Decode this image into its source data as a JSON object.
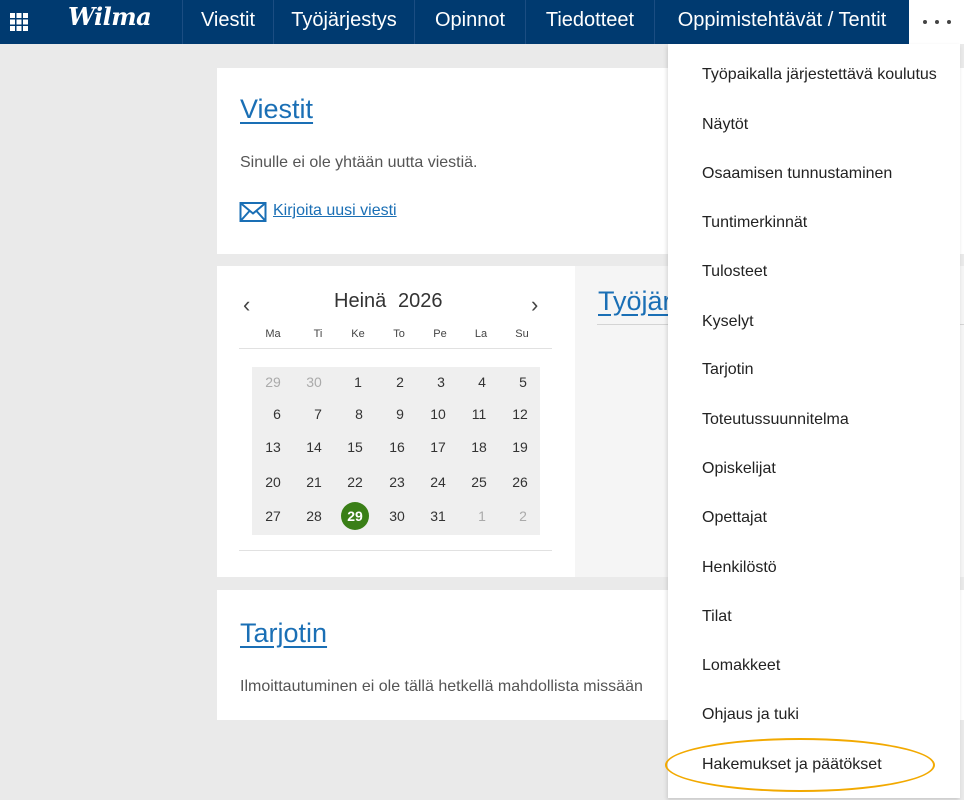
{
  "header": {
    "logo": "Wilma",
    "nav": [
      {
        "label": "Viestit"
      },
      {
        "label": "Työjärjestys"
      },
      {
        "label": "Opinnot"
      },
      {
        "label": "Tiedotteet"
      },
      {
        "label": "Oppimistehtävät / Tentit"
      }
    ],
    "more_icon": "ellipsis-icon",
    "apps_icon": "grid-icon"
  },
  "messages_card": {
    "title": "Viestit",
    "text": "Sinulle ei ole yhtään uutta viestiä.",
    "compose_label": "Kirjoita uusi viesti",
    "compose_icon": "envelope-icon"
  },
  "calendar": {
    "month": "Heinä",
    "year": "2026",
    "prev": "‹",
    "next": "›",
    "weekdays": [
      "Ma",
      "Ti",
      "Ke",
      "To",
      "Pe",
      "La",
      "Su"
    ],
    "weeks": [
      [
        "29",
        "30",
        "1",
        "2",
        "3",
        "4",
        "5"
      ],
      [
        "6",
        "7",
        "8",
        "9",
        "10",
        "11",
        "12"
      ],
      [
        "13",
        "14",
        "15",
        "16",
        "17",
        "18",
        "19"
      ],
      [
        "20",
        "21",
        "22",
        "23",
        "24",
        "25",
        "26"
      ],
      [
        "27",
        "28",
        "29",
        "30",
        "31",
        "1",
        "2"
      ]
    ],
    "today": "29",
    "today_color": "#3a7f17"
  },
  "schedule_card": {
    "title": "Työjär"
  },
  "offering_card": {
    "title": "Tarjotin",
    "text": "Ilmoittautuminen ei ole tällä hetkellä mahdollista missään"
  },
  "dropdown": {
    "items": [
      "Työpaikalla järjestettävä koulutus",
      "Näytöt",
      "Osaamisen tunnustaminen",
      "Tuntimerkinnät",
      "Tulosteet",
      "Kyselyt",
      "Tarjotin",
      "Toteutussuunnitelma",
      "Opiskelijat",
      "Opettajat",
      "Henkilöstö",
      "Tilat",
      "Lomakkeet",
      "Ohjaus ja tuki",
      "Hakemukset ja päätökset"
    ],
    "highlight_color": "#f2a900"
  },
  "colors": {
    "header_bg": "#003a70",
    "link": "#1a6fb5",
    "page_bg": "#eaeaea"
  }
}
